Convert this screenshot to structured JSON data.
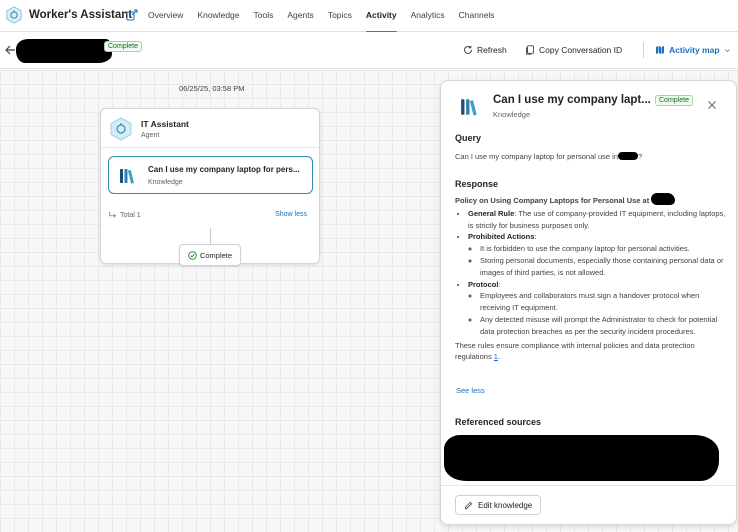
{
  "app": {
    "title": "Worker's Assistant",
    "icon": "agent-hex-icon",
    "share_icon": "share-icon"
  },
  "nav": {
    "tabs": [
      {
        "label": "Overview",
        "active": false
      },
      {
        "label": "Knowledge",
        "active": false
      },
      {
        "label": "Tools",
        "active": false
      },
      {
        "label": "Agents",
        "active": false
      },
      {
        "label": "Topics",
        "active": false
      },
      {
        "label": "Activity",
        "active": true
      },
      {
        "label": "Analytics",
        "active": false
      },
      {
        "label": "Channels",
        "active": false
      }
    ]
  },
  "subbar": {
    "status_badge": "Complete",
    "refresh_label": "Refresh",
    "copy_label": "Copy Conversation ID",
    "map_label": "Activity map"
  },
  "canvas": {
    "timestamp": "06/25/25, 03:58 PM",
    "agent": {
      "name": "IT Assistant",
      "type": "Agent"
    },
    "knowledge_item": {
      "title": "Can I use my company laptop for pers...",
      "type": "Knowledge"
    },
    "total_label": "Total 1",
    "show_less_label": "Show less",
    "complete_label": "Complete"
  },
  "panel": {
    "title": "Can I use my company lapt...",
    "badge": "Complete",
    "subtitle": "Knowledge",
    "query_heading": "Query",
    "query_text_before": "Can I use my company laptop for personal use in",
    "query_text_after": "?",
    "response_heading": "Response",
    "response": {
      "title": "Policy on Using Company Laptops for Personal Use at",
      "general_rule_label": "General Rule",
      "general_rule_text": ": The use of company-provided IT equipment, including laptops, is strictly for business purposes only.",
      "prohibited_label": "Prohibited Actions",
      "prohibited_items": [
        "It is forbidden to use the company laptop for personal activities.",
        "Storing personal documents, especially those containing personal data or images of third parties, is not allowed."
      ],
      "protocol_label": "Protocol",
      "protocol_items": [
        "Employees and collaborators must sign a handover protocol when receiving IT equipment.",
        "Any detected misuse will prompt the Administrator to check for potential data protection breaches as per the security incident procedures."
      ],
      "footer_text": "These rules ensure compliance with internal policies and data protection regulations",
      "citation": "1",
      "footer_end": "."
    },
    "see_less_label": "See less",
    "sources_heading": "Referenced sources",
    "edit_button_label": "Edit knowledge"
  },
  "colors": {
    "accent": "#1e8ba0",
    "link": "#1b6ec2",
    "complete_green": "#0e700e"
  }
}
